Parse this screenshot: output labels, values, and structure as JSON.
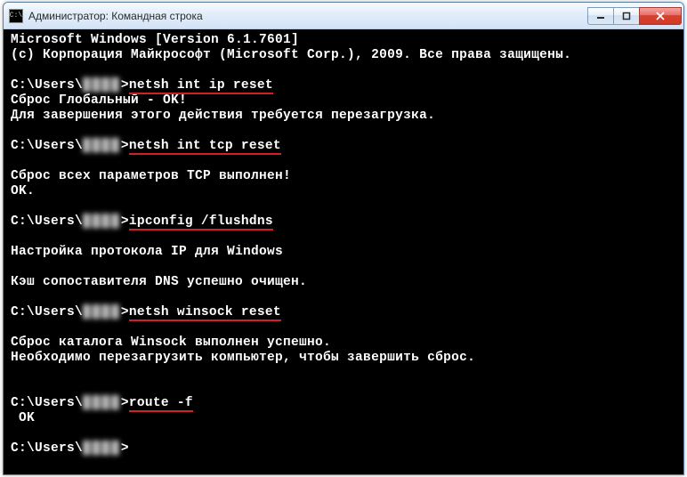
{
  "window": {
    "title": "Администратор: Командная строка",
    "icon_label": "C:\\"
  },
  "terminal": {
    "version_line": "Microsoft Windows [Version 6.1.7601]",
    "copyright_line": "(c) Корпорация Майкрософт (Microsoft Corp.), 2009. Все права защищены.",
    "prompt_prefix": "C:\\Users\\",
    "prompt_user_placeholder": "████",
    "prompt_suffix": ">",
    "cmd1": "netsh int ip reset",
    "out1a": "Сброс Глобальный - OK!",
    "out1b": "Для завершения этого действия требуется перезагрузка.",
    "cmd2": "netsh int tcp reset",
    "out2a": "Сброс всех параметров TCP выполнен!",
    "out2b": "OK.",
    "cmd3": "ipconfig /flushdns",
    "out3a": "Настройка протокола IP для Windows",
    "out3b": "Кэш сопоставителя DNS успешно очищен.",
    "cmd4": "netsh winsock reset",
    "out4a": "Сброс каталога Winsock выполнен успешно.",
    "out4b": "Необходимо перезагрузить компьютер, чтобы завершить сброс.",
    "cmd5": "route -f",
    "out5a": " OK"
  }
}
